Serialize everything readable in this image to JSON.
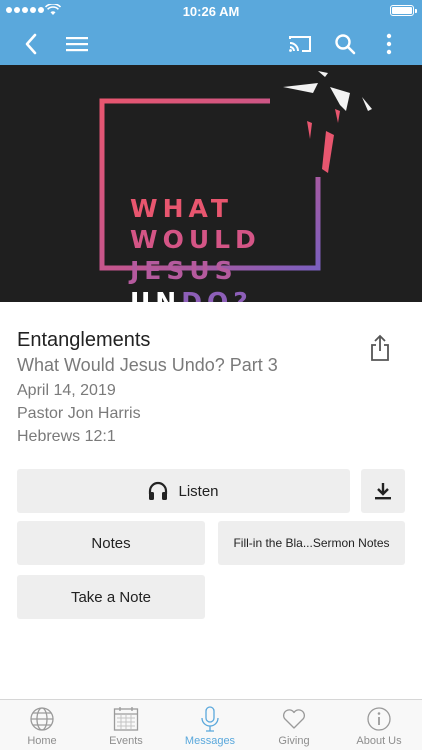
{
  "status_bar": {
    "time": "10:26 AM"
  },
  "nav": {
    "back_icon": "chevron-left-icon",
    "menu_icon": "hamburger-menu-icon",
    "cast_icon": "cast-icon",
    "search_icon": "search-icon",
    "more_icon": "more-vertical-icon"
  },
  "artwork": {
    "lines": [
      "WHAT",
      "WOULD",
      "JESUS",
      "DO?"
    ],
    "line4_prefix": "UN"
  },
  "sermon": {
    "title": "Entanglements",
    "series": "What Would Jesus Undo? Part 3",
    "date": "April 14, 2019",
    "speaker": "Pastor Jon Harris",
    "scripture": "Hebrews 12:1"
  },
  "actions": {
    "listen": "Listen",
    "notes": "Notes",
    "fill_in": "Fill-in the Bla...Sermon Notes",
    "take_note": "Take a Note"
  },
  "tabs": [
    {
      "label": "Home",
      "icon": "globe-icon"
    },
    {
      "label": "Events",
      "icon": "calendar-icon"
    },
    {
      "label": "Messages",
      "icon": "microphone-icon"
    },
    {
      "label": "Giving",
      "icon": "heart-icon"
    },
    {
      "label": "About Us",
      "icon": "info-icon"
    }
  ],
  "colors": {
    "accent": "#5aa8dc",
    "button_bg": "#eeeeee",
    "tab_inactive": "#8e8e8e"
  }
}
